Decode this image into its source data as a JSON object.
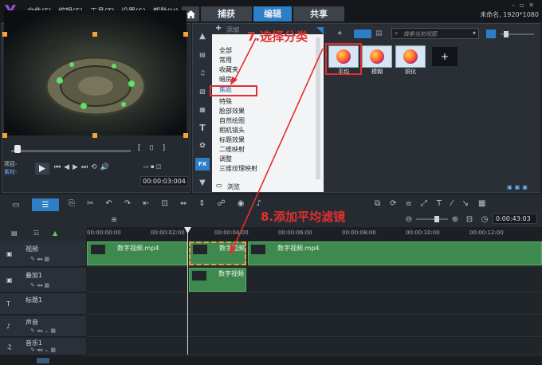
{
  "window": {
    "menus": [
      "文件(F)",
      "编辑(E)",
      "工具(T)",
      "设置(S)",
      "帮助(H)"
    ],
    "tabs": [
      "捕获",
      "编辑",
      "共享"
    ],
    "active_tab": "编辑",
    "project_info": "未命名, 1920*1080"
  },
  "player": {
    "mode_project": "项目-",
    "mode_clip": "素材-",
    "timecode": "00:00:03:004",
    "hd_label": "HD",
    "frame_label": "[ ]"
  },
  "library": {
    "add_label": "添加",
    "search_placeholder": "搜索当前视图",
    "categories": [
      "全部",
      "常用",
      "收藏夹",
      "暗房",
      "焦距",
      "特殊",
      "脸部效果",
      "自然绘图",
      "相机镜头",
      "标题效果",
      "二维映射",
      "调整",
      "三维纹理映射"
    ],
    "selected_category": "焦距",
    "browse_label": "浏览",
    "filters": [
      "平均",
      "模糊",
      "锐化"
    ],
    "selected_filter": "平均"
  },
  "annotations": {
    "step7": "7.选择分类",
    "step8": "8.添加平均滤镜"
  },
  "timeline": {
    "timecode": "0:00:43:03",
    "ruler_ticks": [
      "00:00:00:00",
      "00:00:02:00",
      "00:00:04:00",
      "00:00:06:00",
      "00:00:08:00",
      "00:00:10:00",
      "00:00:12:00"
    ],
    "tracks": [
      "视频",
      "叠加1",
      "标题1",
      "声音",
      "音乐1"
    ],
    "clips": {
      "video_1": "数字视频.mp4",
      "video_2": "数字视频",
      "video_3": "数字视频.mp4",
      "overlay_1": "数字视频"
    }
  },
  "colors": {
    "accent": "#2c7fc7",
    "annotation": "#e23030",
    "clip": "#3e8a4e"
  }
}
